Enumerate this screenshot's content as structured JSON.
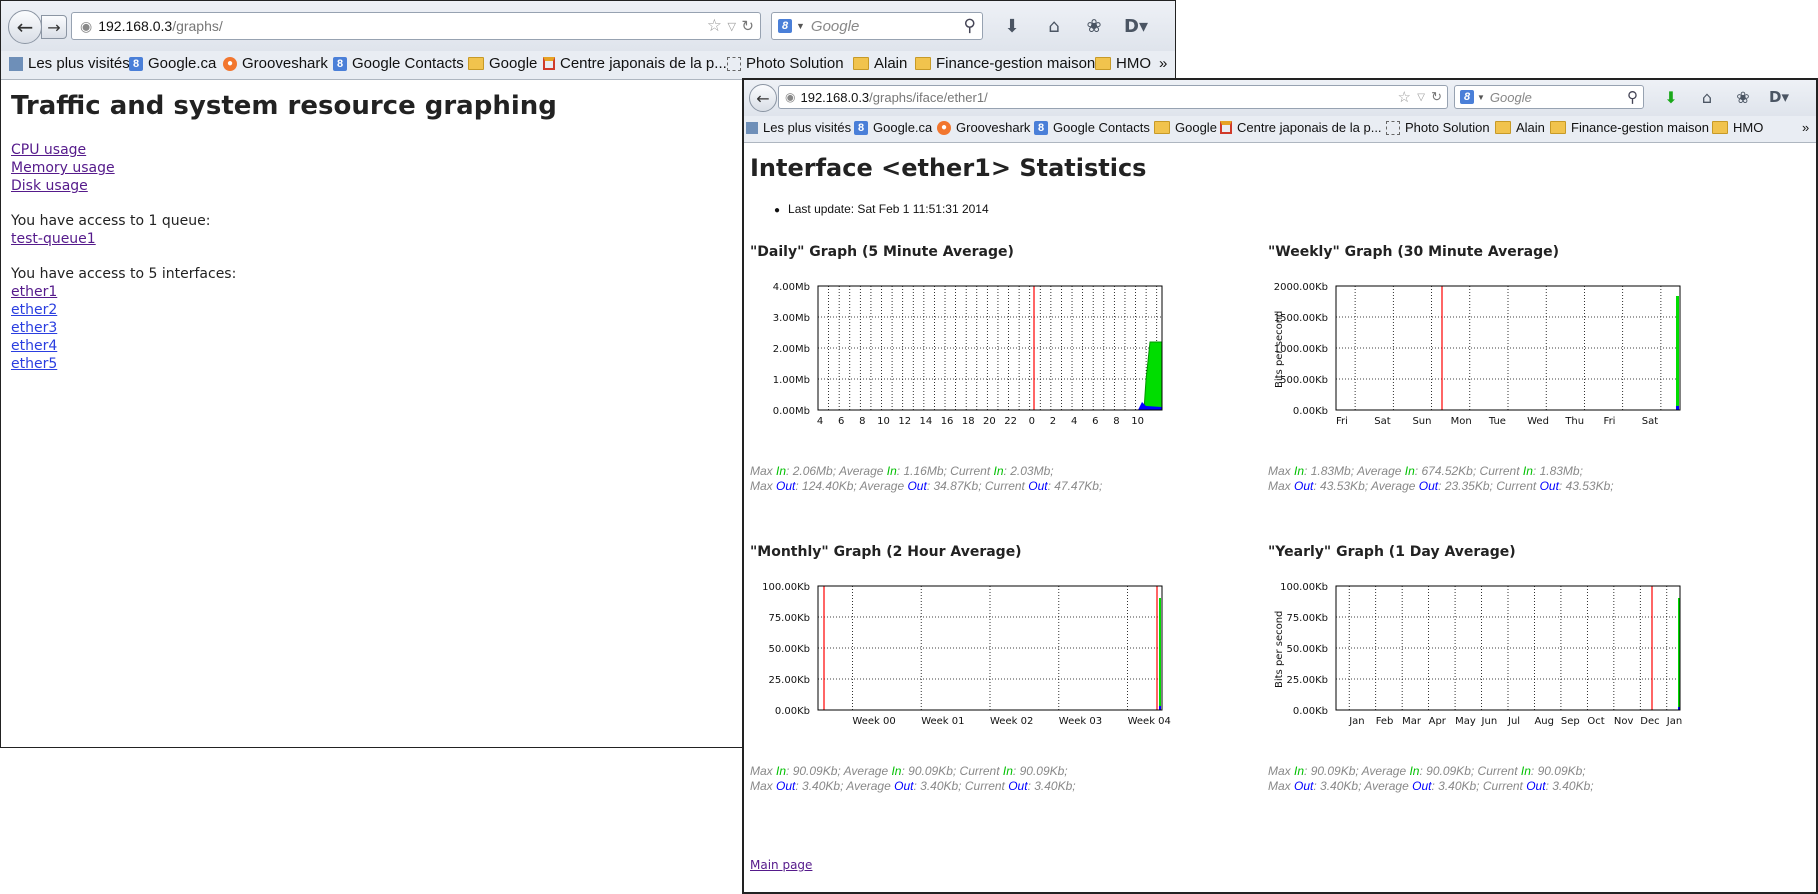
{
  "window1": {
    "url_host": "192.168.0.3",
    "url_path": "/graphs/",
    "search_placeholder": "Google",
    "title": "Traffic and system resource graphing",
    "links": [
      "CPU usage",
      "Memory usage",
      "Disk usage"
    ],
    "queue_text": "You have access to 1 queue:",
    "queues": [
      "test-queue1"
    ],
    "interfaces_text": "You have access to 5 interfaces:",
    "interfaces": [
      "ether1",
      "ether2",
      "ether3",
      "ether4",
      "ether5"
    ]
  },
  "bookmarks": [
    "Les plus visités",
    "Google.ca",
    "Grooveshark",
    "Google Contacts",
    "Google",
    "Centre japonais de la p...",
    "Photo Solution",
    "Alain",
    "Finance-gestion maison",
    "HMO"
  ],
  "bookmarks_more": "»",
  "window2": {
    "url_host": "192.168.0.3",
    "url_path": "/graphs/iface/ether1/",
    "search_placeholder": "Google",
    "title": "Interface <ether1> Statistics",
    "last_update": "Last update: Sat Feb 1 11:51:31 2014",
    "main_page_link": "Main page",
    "graphs": [
      {
        "title": "\"Daily\" Graph (5 Minute Average)",
        "ylabel": "",
        "y_ticks": [
          "4.00Mb",
          "3.00Mb",
          "2.00Mb",
          "1.00Mb",
          "0.00Mb"
        ],
        "x_ticks": [
          "4",
          "6",
          "8",
          "10",
          "12",
          "14",
          "16",
          "18",
          "20",
          "22",
          "0",
          "2",
          "4",
          "6",
          "8",
          "10"
        ],
        "stats_in": {
          "max": "2.06Mb;",
          "avg": "1.16Mb;",
          "cur": "2.03Mb;"
        },
        "stats_out": {
          "max": "124.40Kb;",
          "avg": "34.87Kb;",
          "cur": "47.47Kb;"
        }
      },
      {
        "title": "\"Weekly\" Graph (30 Minute Average)",
        "ylabel": "Bits per second",
        "y_ticks": [
          "2000.00Kb",
          "1500.00Kb",
          "1000.00Kb",
          "500.00Kb",
          "0.00Kb"
        ],
        "x_ticks": [
          "Fri",
          "Sat",
          "Sun",
          "Mon",
          "Tue",
          "Wed",
          "Thu",
          "Fri",
          "Sat"
        ],
        "stats_in": {
          "max": "1.83Mb;",
          "avg": "674.52Kb;",
          "cur": "1.83Mb;"
        },
        "stats_out": {
          "max": "43.53Kb;",
          "avg": "23.35Kb;",
          "cur": "43.53Kb;"
        }
      },
      {
        "title": "\"Monthly\" Graph (2 Hour Average)",
        "ylabel": "",
        "y_ticks": [
          "100.00Kb",
          "75.00Kb",
          "50.00Kb",
          "25.00Kb",
          "0.00Kb"
        ],
        "x_ticks": [
          "Week 00",
          "Week 01",
          "Week 02",
          "Week 03",
          "Week 04"
        ],
        "stats_in": {
          "max": "90.09Kb;",
          "avg": "90.09Kb;",
          "cur": "90.09Kb;"
        },
        "stats_out": {
          "max": "3.40Kb;",
          "avg": "3.40Kb;",
          "cur": "3.40Kb;"
        }
      },
      {
        "title": "\"Yearly\" Graph (1 Day Average)",
        "ylabel": "Bits per second",
        "y_ticks": [
          "100.00Kb",
          "75.00Kb",
          "50.00Kb",
          "25.00Kb",
          "0.00Kb"
        ],
        "x_ticks": [
          "Jan",
          "Feb",
          "Mar",
          "Apr",
          "May",
          "Jun",
          "Jul",
          "Aug",
          "Sep",
          "Oct",
          "Nov",
          "Dec",
          "Jan"
        ],
        "stats_in": {
          "max": "90.09Kb;",
          "avg": "90.09Kb;",
          "cur": "90.09Kb;"
        },
        "stats_out": {
          "max": "3.40Kb;",
          "avg": "3.40Kb;",
          "cur": "3.40Kb;"
        }
      }
    ],
    "stat_labels": {
      "max": "Max",
      "avg": "Average",
      "cur": "Current",
      "in": "In",
      "out": "Out"
    }
  },
  "colors": {
    "in_fill": "#00dd00",
    "out_fill": "#0000ff",
    "now_marker": "#ff0000",
    "grid": "#888888"
  }
}
